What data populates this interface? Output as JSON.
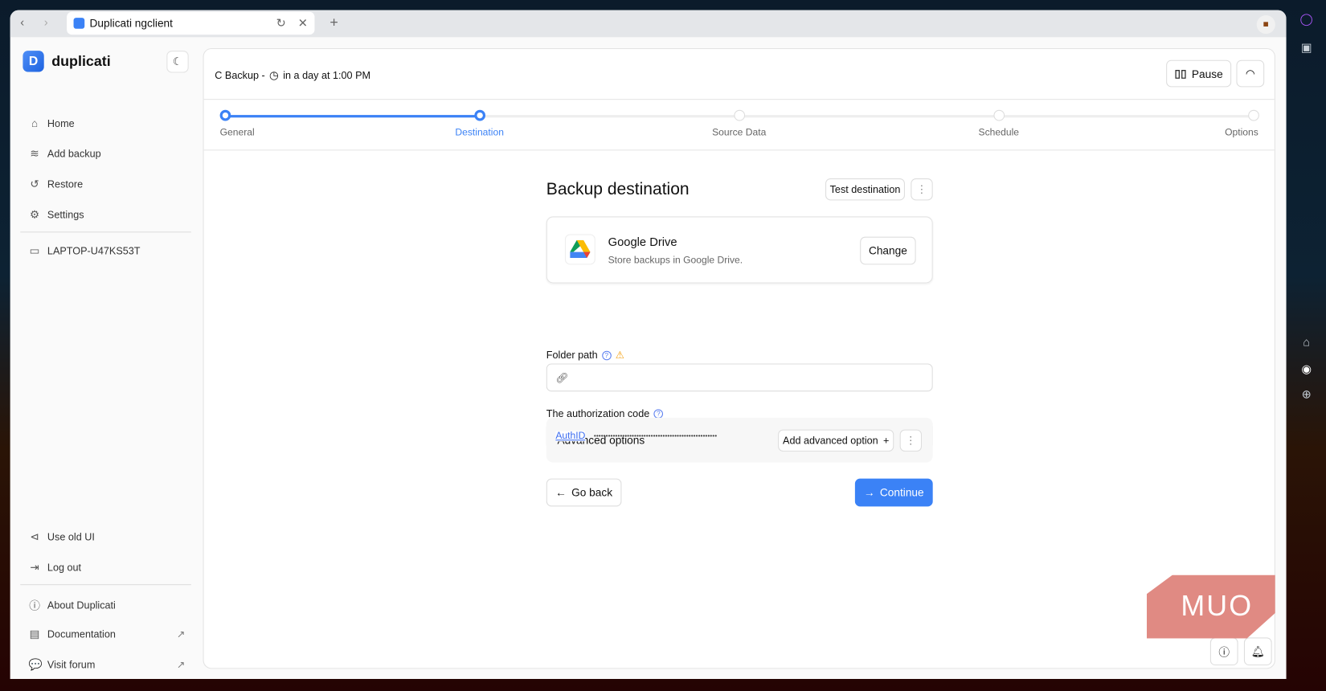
{
  "browser": {
    "tab_title": "Duplicati ngclient"
  },
  "sidebar": {
    "brand": "duplicati",
    "items": [
      {
        "label": "Home"
      },
      {
        "label": "Add backup"
      },
      {
        "label": "Restore"
      },
      {
        "label": "Settings"
      }
    ],
    "machine": "LAPTOP-U47KS53T",
    "bottom": [
      {
        "label": "Use old UI"
      },
      {
        "label": "Log out"
      }
    ],
    "links": [
      {
        "label": "About Duplicati"
      },
      {
        "label": "Documentation"
      },
      {
        "label": "Visit forum"
      }
    ]
  },
  "header": {
    "backup_name": "C Backup -",
    "schedule": "in a day at 1:00 PM",
    "pause_label": "Pause"
  },
  "steps": [
    {
      "label": "General"
    },
    {
      "label": "Destination"
    },
    {
      "label": "Source Data"
    },
    {
      "label": "Schedule"
    },
    {
      "label": "Options"
    }
  ],
  "steps_current": 1,
  "destination": {
    "title": "Backup destination",
    "test_label": "Test destination",
    "provider": {
      "name": "Google Drive",
      "description": "Store backups in Google Drive.",
      "change_label": "Change"
    },
    "folder_label": "Folder path",
    "folder_value": "",
    "auth_label": "The authorization code",
    "auth_link": "AuthID",
    "auth_value": "••••••••••••••••••••••••••••••••••••••••••••••••••••",
    "advanced_label": "Advanced options",
    "add_advanced_label": "Add advanced option",
    "back_label": "Go back",
    "continue_label": "Continue"
  },
  "watermark": "MUO",
  "colors": {
    "accent": "#3b82f6",
    "warning": "#f59e0b"
  }
}
